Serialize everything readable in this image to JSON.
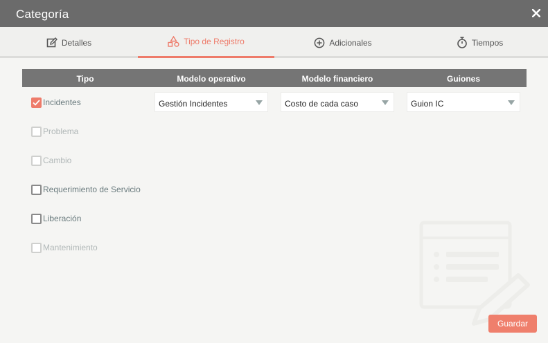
{
  "window": {
    "title": "Categoría",
    "close_icon": "close-icon"
  },
  "tabs": [
    {
      "label": "Detalles",
      "icon": "edit-icon",
      "active": false
    },
    {
      "label": "Tipo de Registro",
      "icon": "shapes-icon",
      "active": true
    },
    {
      "label": "Adicionales",
      "icon": "plus-circle-icon",
      "active": false
    },
    {
      "label": "Tiempos",
      "icon": "stopwatch-icon",
      "active": false
    }
  ],
  "table": {
    "headers": [
      "Tipo",
      "Modelo operativo",
      "Modelo financiero",
      "Guiones"
    ],
    "types": [
      {
        "label": "Incidentes",
        "checked": true,
        "enabled": true
      },
      {
        "label": "Problema",
        "checked": false,
        "enabled": false
      },
      {
        "label": "Cambio",
        "checked": false,
        "enabled": false
      },
      {
        "label": "Requerimiento de Servicio",
        "checked": false,
        "enabled": true
      },
      {
        "label": "Liberación",
        "checked": false,
        "enabled": true
      },
      {
        "label": "Mantenimiento",
        "checked": false,
        "enabled": false
      }
    ],
    "selects": {
      "modelo_operativo": "Gestión Incidentes",
      "modelo_financiero": "Costo de cada caso",
      "guiones": "Guion IC"
    }
  },
  "colors": {
    "accent": "#ee7b6a",
    "titlebar": "#6b6b6b",
    "header": "#757575"
  },
  "footer": {
    "save_label": "Guardar"
  }
}
